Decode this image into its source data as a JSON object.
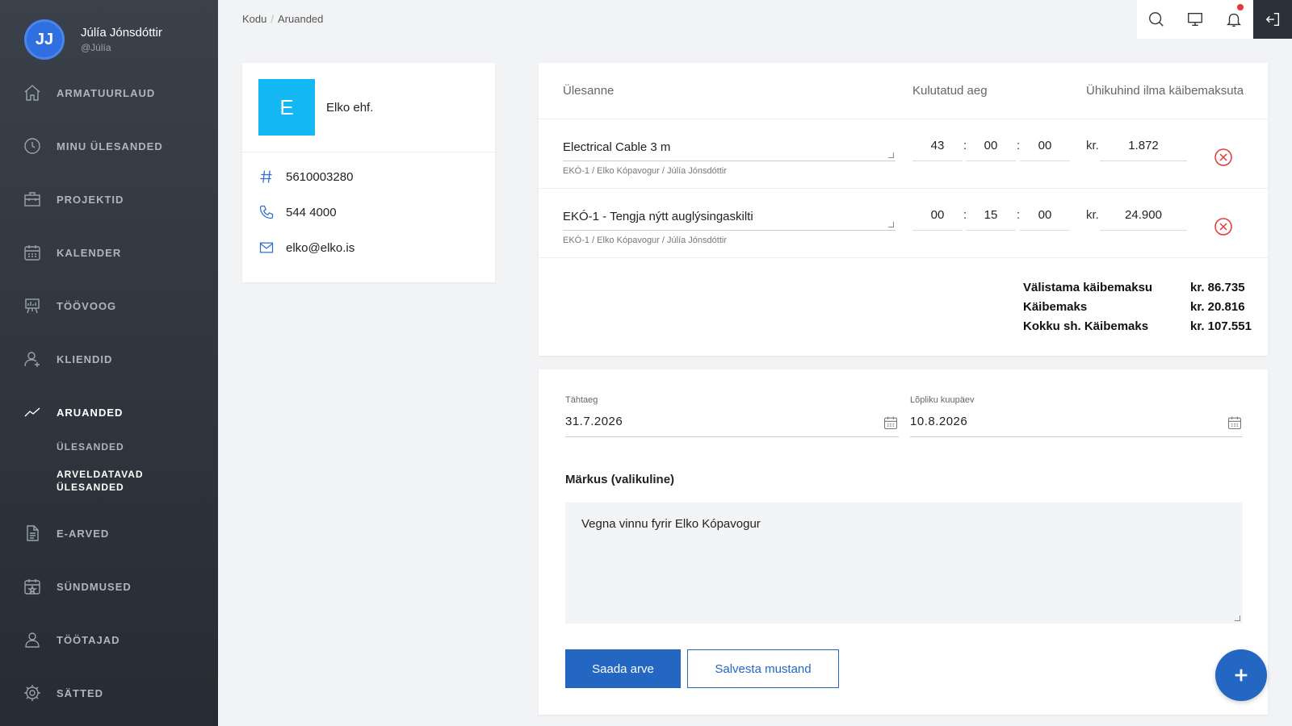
{
  "user": {
    "initials": "JJ",
    "name": "Júlía Jónsdóttir",
    "handle": "@Júlía"
  },
  "nav": {
    "dashboard": "ARMATUURLAUD",
    "my_tasks": "MINU ÜLESANDED",
    "projects": "PROJEKTID",
    "calendar": "KALENDER",
    "workflow": "TÖÖVOOG",
    "clients": "KLIENDID",
    "reports": "ARUANDED",
    "reports_sub_tasks": "ÜLESANDED",
    "reports_sub_billable": "ARVELDATAVAD ÜLESANDED",
    "einvoices": "E-ARVED",
    "events": "SÜNDMUSED",
    "employees": "TÖÖTAJAD",
    "settings": "SÄTTED"
  },
  "breadcrumb": {
    "home": "Kodu",
    "separator": "/",
    "current": "Aruanded"
  },
  "customer": {
    "logo_letter": "E",
    "name": "Elko ehf.",
    "id_number": "5610003280",
    "phone": "544 4000",
    "email": "elko@elko.is",
    "logo_color": "#13b8f2"
  },
  "table": {
    "headers": {
      "task": "Ülesanne",
      "time": "Kulutatud aeg",
      "unit_price": "Ühikuhind ilma käibemaksuta"
    },
    "currency": "kr.",
    "time_sep": ":",
    "rows": [
      {
        "name": "Electrical Cable 3 m",
        "sub": "EKÓ-1 / Elko Kópavogur / Júlía Jónsdóttir",
        "h": "43",
        "m": "00",
        "s": "00",
        "price": "1.872"
      },
      {
        "name": "EKÓ-1 - Tengja nýtt auglýsingaskilti",
        "sub": "EKÓ-1 / Elko Kópavogur / Júlía Jónsdóttir",
        "h": "00",
        "m": "15",
        "s": "00",
        "price": "24.900"
      }
    ],
    "totals": {
      "excl_vat_label": "Välistama käibemaksu",
      "excl_vat_value": "kr. 86.735",
      "vat_label": "Käibemaks",
      "vat_value": "kr. 20.816",
      "total_label": "Kokku sh. Käibemaks",
      "total_value": "kr. 107.551"
    }
  },
  "form": {
    "due_label": "Tähtaeg",
    "due_value": "31.7.2026",
    "final_label": "Lõpliku kuupäev",
    "final_value": "10.8.2026",
    "notes_title": "Märkus (valikuline)",
    "notes_value": "Vegna vinnu fyrir Elko Kópavogur",
    "send_button": "Saada arve",
    "save_button": "Salvesta mustand"
  },
  "colors": {
    "primary": "#2467c3",
    "danger": "#e53935",
    "sidebar": "#2b3139"
  }
}
